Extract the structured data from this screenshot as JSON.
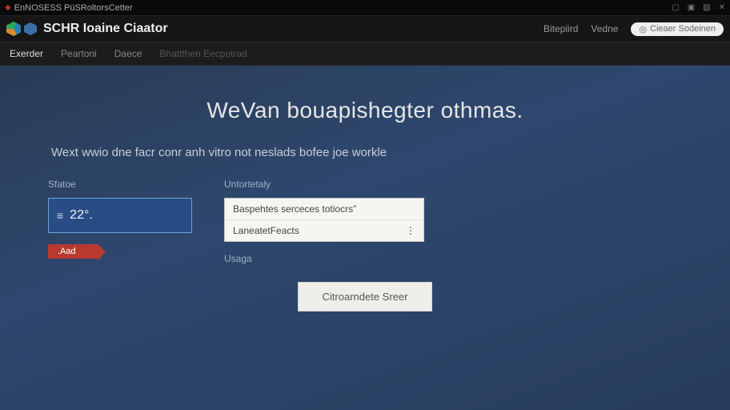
{
  "titlebar": {
    "text": "EnNOSESS PüSRoltorsCetter"
  },
  "header": {
    "app_title": "SCHR Ioaine Ciaator",
    "links": {
      "a": "Bitepiird",
      "b": "Vedne"
    },
    "search_placeholder": "Cieaer Sodeinen"
  },
  "tabs": {
    "t0": "Exerder",
    "t1": "Peartoni",
    "t2": "Daece",
    "t3": "Bhattthen Eecpotrad"
  },
  "page": {
    "hero": "WeVan bouapishegter othmas.",
    "subtitle": "Wext wwio dne facr conr anh vitro not neslads bofee joe workle",
    "col1_label": "Sfatoe",
    "input_value": "22°.",
    "tag_label": ".Aad",
    "col2_label": "Untortetaly",
    "dropdown": {
      "opt1": "Baspehtes serceces totiocrs”",
      "opt2": "LaneatetFeacts"
    },
    "usage_label": "Usaga",
    "submit": "Citroarndete Sreer"
  }
}
